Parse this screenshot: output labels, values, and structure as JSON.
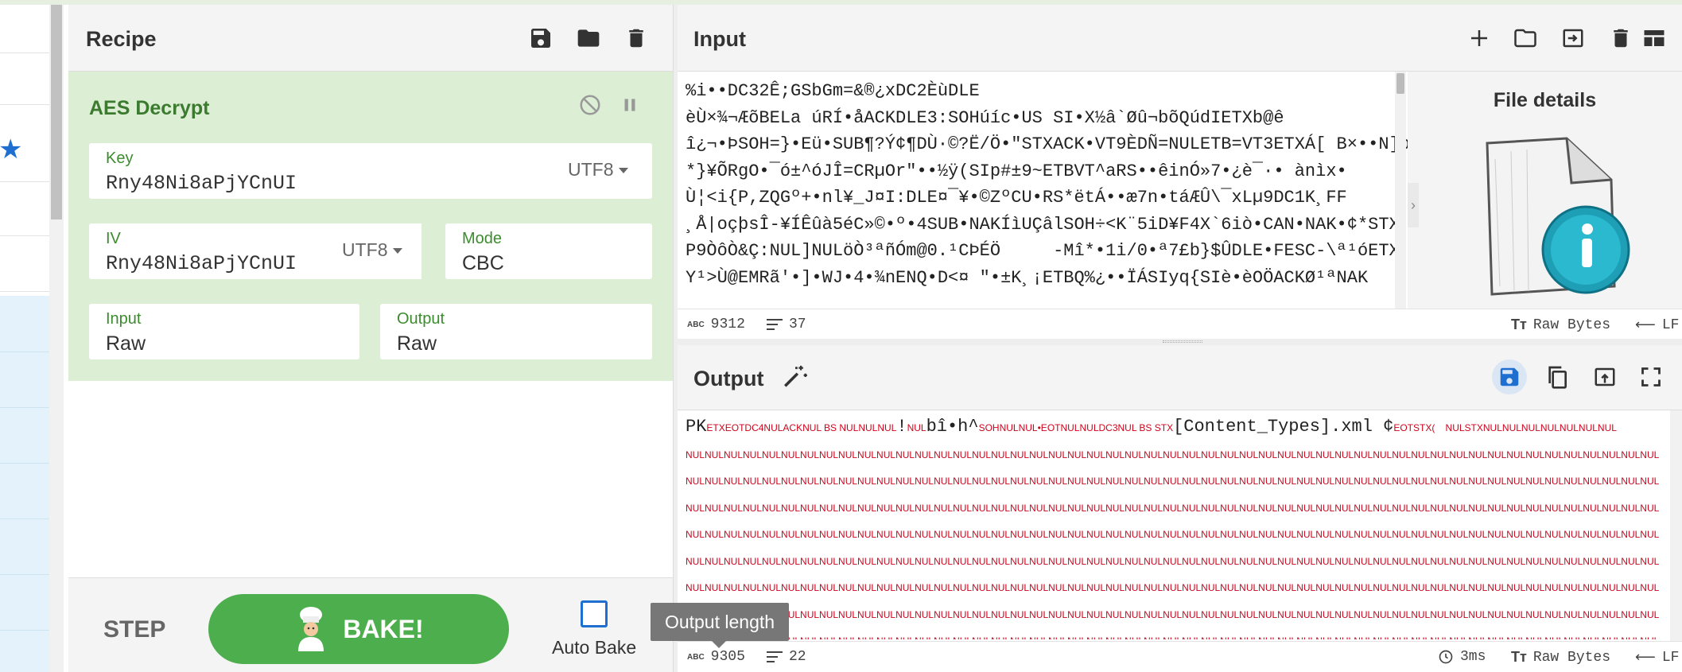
{
  "recipe": {
    "title": "Recipe",
    "operation": {
      "name": "AES Decrypt",
      "key": {
        "label": "Key",
        "value": "Rny48Ni8aPjYCnUI",
        "encoding": "UTF8"
      },
      "iv": {
        "label": "IV",
        "value": "Rny48Ni8aPjYCnUI",
        "encoding": "UTF8"
      },
      "mode": {
        "label": "Mode",
        "value": "CBC"
      },
      "input": {
        "label": "Input",
        "value": "Raw"
      },
      "output": {
        "label": "Output",
        "value": "Raw"
      }
    },
    "step_label": "STEP",
    "bake_label": "BAKE!",
    "auto_bake_label": "Auto Bake"
  },
  "input_panel": {
    "title": "Input",
    "file_details_title": "File details",
    "lines": [
      "%i••DC32Ê;GSbGm=&®¿xDC2ÈùDLE",
      "èÙ×¾¬ÆõBELa úRÍ•åACKDLE3:SOHúíc•US SI•X½â`Øû¬bõQúdIETXb@ê",
      "î¿¬•ÞSOH=}•Eü•SUB¶?Ý¢¶DÙ·©?Ë/Ö•\"STXACK•VT9ÈDÑ=NULETB=VT3ETXÁ[ B×••N]pÉùÔg•",
      "*}¥ÕRgO•¯ó±^óJÎ=CRµOr\"••½ÿ(SIp#±9~ETBVT^aRS••êinÓ»7•¿è¯·• ànìx•",
      "Ù¦<i{P,ZQGº+•nl¥_J¤I:DLE¤¯¥•©ZºCU•RS*ëtÁ••æ7n•táÆÛ\\¯xLµ9DC1K¸FF",
      "¸Å|oçþsÎ-¥ÍÊûà5éC»©•º•4SUB•NAKÍìUÇâlSOH÷<K¨5iD¥F4X`6iò•CAN•NAK•¢*STX",
      "P9ÒôÒ&Ç:NUL]NULöÒ³ªñÓm@0.¹CÞÉÖ     -Mî*•1i/0•ª7£b}$ÛDLE•FESC-\\ª¹óETX",
      "Y¹>Ù@EMRã'•]•WJ•4•¾nENQ•D<¤ \"•±K¸¡ETBQ%¿••ÏÁSIyq{SIè•èOÖACKØ¹ªNAK"
    ],
    "status": {
      "length": "9312",
      "lines": "37",
      "format": "Raw Bytes",
      "eol": "LF"
    }
  },
  "output_panel": {
    "title": "Output",
    "first_line_prefix": "PK",
    "first_line_ctrl_a": "ETXEOTDC4NULACKNUL BS NULNULNUL",
    "first_line_mid": "!",
    "first_line_ctrl_b": "NUL",
    "first_line_text_b": "bî•h^",
    "first_line_ctrl_c": "SOHNULNUL•EOTNULNULDC3NUL BS STX",
    "first_line_text_c": "[Content_Types].xml ¢",
    "first_line_ctrl_d": "EOTSTX(",
    "first_line_ctrl_e": "NULSTXNULNULNULNULNULNULNUL",
    "nul_row": "NULNULNULNULNULNULNULNULNULNULNULNULNULNULNULNULNULNULNULNULNULNULNULNULNULNULNULNULNULNULNULNULNULNULNULNULNULNULNULNULNULNULNULNULNULNULNULNULNULNULNUL",
    "status": {
      "length": "9305",
      "lines": "22",
      "time": "3ms",
      "format": "Raw Bytes",
      "eol": "LF"
    },
    "tooltip": "Output length"
  },
  "colors": {
    "accent_green": "#4cae4c",
    "op_bg": "#dcefd5",
    "label_green": "#3c8c2f",
    "ctrl_red": "#d0021b",
    "link_blue": "#1f6fd1"
  }
}
